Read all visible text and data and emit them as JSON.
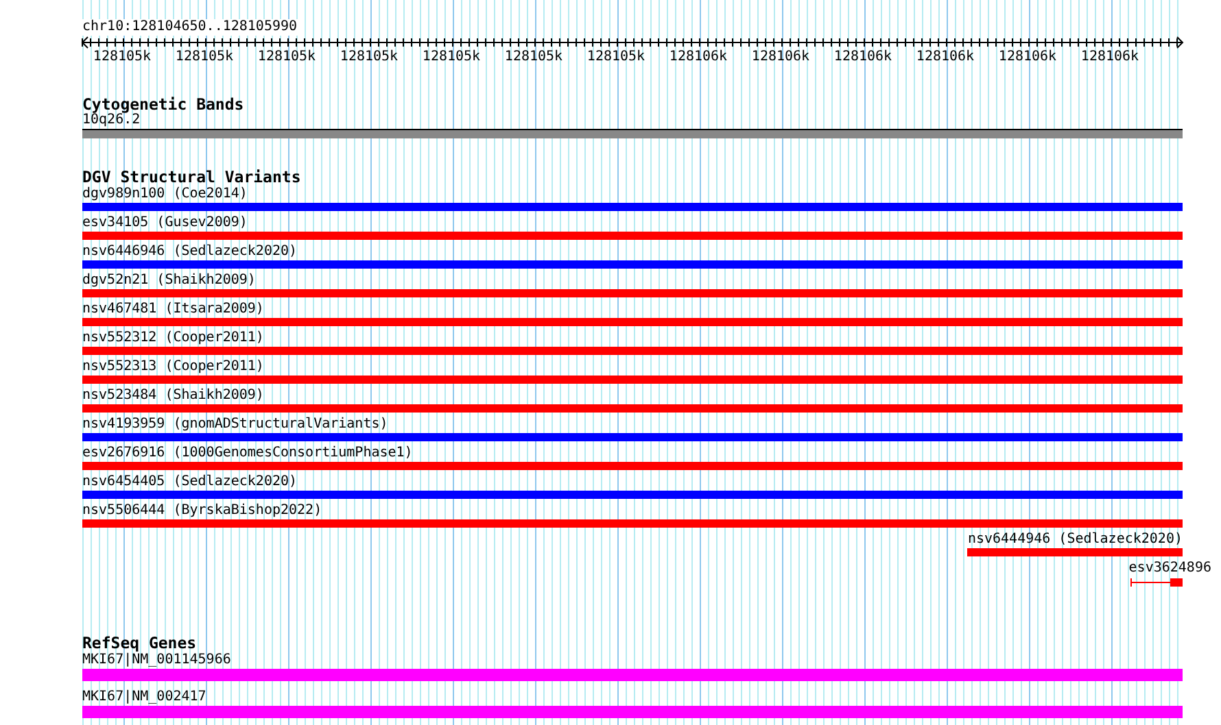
{
  "ruler": {
    "location": "chr10:128104650..128105990",
    "tick_labels": [
      "128105k",
      "128105k",
      "128105k",
      "128105k",
      "128105k",
      "128105k",
      "128105k",
      "128106k",
      "128106k",
      "128106k",
      "128106k",
      "128106k",
      "128106k"
    ]
  },
  "cytogenetic_bands": {
    "title": "Cytogenetic Bands",
    "features": [
      {
        "label": "10q26.2"
      }
    ]
  },
  "dgv_structural_variants": {
    "title": "DGV Structural Variants",
    "features": [
      {
        "label": "dgv989n100 (Coe2014)",
        "color": "#0000ff",
        "kind": "full"
      },
      {
        "label": "esv34105 (Gusev2009)",
        "color": "#ff0000",
        "kind": "full"
      },
      {
        "label": "nsv6446946 (Sedlazeck2020)",
        "color": "#0000ff",
        "kind": "full"
      },
      {
        "label": "dgv52n21 (Shaikh2009)",
        "color": "#ff0000",
        "kind": "full"
      },
      {
        "label": "nsv467481 (Itsara2009)",
        "color": "#ff0000",
        "kind": "full"
      },
      {
        "label": "nsv552312 (Cooper2011)",
        "color": "#ff0000",
        "kind": "full"
      },
      {
        "label": "nsv552313 (Cooper2011)",
        "color": "#ff0000",
        "kind": "full"
      },
      {
        "label": "nsv523484 (Shaikh2009)",
        "color": "#ff0000",
        "kind": "full"
      },
      {
        "label": "nsv4193959 (gnomADStructuralVariants)",
        "color": "#0000ff",
        "kind": "full"
      },
      {
        "label": "esv2676916 (1000GenomesConsortiumPhase1)",
        "color": "#ff0000",
        "kind": "full"
      },
      {
        "label": "nsv6454405 (Sedlazeck2020)",
        "color": "#0000ff",
        "kind": "full"
      },
      {
        "label": "nsv5506444 (ByrskaBishop2022)",
        "color": "#ff0000",
        "kind": "full"
      },
      {
        "label": "nsv6444946 (Sedlazeck2020)",
        "color": "#ff0000",
        "kind": "right"
      },
      {
        "label": "esv3624896",
        "color": "#ff0000",
        "kind": "short"
      }
    ]
  },
  "refseq_genes": {
    "title": "RefSeq Genes",
    "features": [
      {
        "label": "MKI67|NM_001145966"
      },
      {
        "label": "MKI67|NM_002417"
      }
    ]
  }
}
